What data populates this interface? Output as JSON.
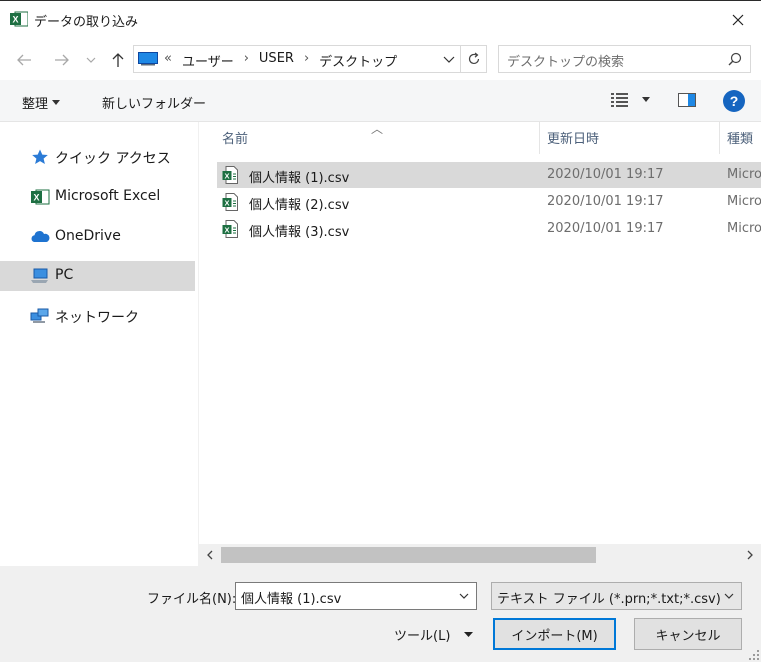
{
  "window": {
    "title": "データの取り込み"
  },
  "address": {
    "crumbs": [
      "«",
      "ユーザー",
      "›",
      "USER",
      "›",
      "デスクトップ"
    ]
  },
  "search": {
    "placeholder": "デスクトップの検索"
  },
  "toolbar": {
    "organize_label": "整理",
    "new_folder_label": "新しいフォルダー"
  },
  "sidebar": {
    "items": [
      {
        "label": "クイック アクセス",
        "icon": "star-icon"
      },
      {
        "label": "Microsoft Excel",
        "icon": "excel-icon"
      },
      {
        "label": "OneDrive",
        "icon": "cloud-icon"
      },
      {
        "label": "PC",
        "icon": "computer-icon",
        "selected": true
      },
      {
        "label": "ネットワーク",
        "icon": "network-icon"
      }
    ]
  },
  "files": {
    "columns": {
      "name": "名前",
      "date": "更新日時",
      "type": "種類"
    },
    "rows": [
      {
        "name": "個人情報 (1).csv",
        "date": "2020/10/01 19:17",
        "type": "Micro",
        "selected": true
      },
      {
        "name": "個人情報 (2).csv",
        "date": "2020/10/01 19:17",
        "type": "Micro"
      },
      {
        "name": "個人情報 (3).csv",
        "date": "2020/10/01 19:17",
        "type": "Micro"
      }
    ]
  },
  "bottom": {
    "filename_label": "ファイル名(N):",
    "filename_value": "個人情報 (1).csv",
    "filetype_value": "テキスト ファイル (*.prn;*.txt;*.csv)",
    "tools_label": "ツール(L)",
    "import_label": "インポート(M)",
    "cancel_label": "キャンセル"
  },
  "colors": {
    "accent": "#0078d7",
    "excel_green": "#1d6f42",
    "selection": "#d9d9d9"
  }
}
